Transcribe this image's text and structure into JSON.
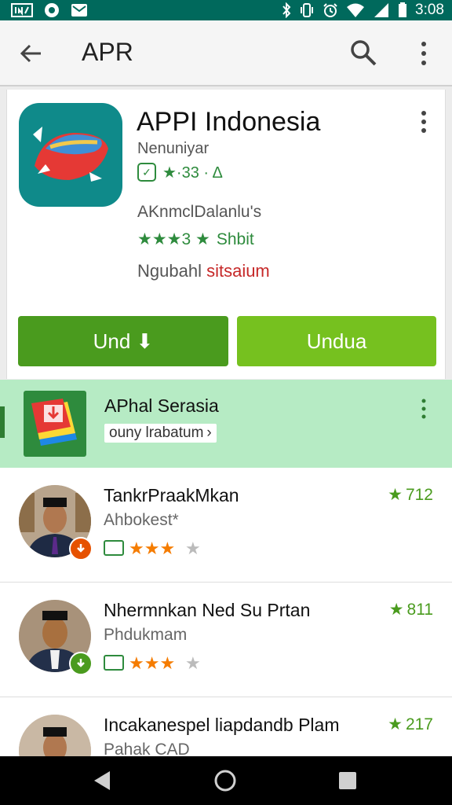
{
  "status_bar": {
    "time": "3:08",
    "left_icons": [
      "notification-app-icon",
      "circle-notification-icon",
      "mail-notification-icon"
    ],
    "right_icons": [
      "bluetooth-icon",
      "vibrate-icon",
      "alarm-icon",
      "wifi-icon",
      "signal-icon",
      "battery-icon"
    ]
  },
  "app_bar": {
    "title": "APR"
  },
  "app_card": {
    "name": "APPI Indonesia",
    "developer": "Nenuniyar",
    "badge_icon": "check-badge-icon",
    "rating_text": "★·33 · Δ",
    "subtitle": "AKnmclDalanlu's",
    "stars_text": "★★★3 ★",
    "stars_label": "Shbit",
    "status_label": "Ngubahl",
    "status_value": "sitsaium",
    "buttons": {
      "primary_label": "Und ⬇",
      "secondary_label": "Undua"
    }
  },
  "promo": {
    "title": "APhal Serasia",
    "chip_label": "ouny lrabatum"
  },
  "list": {
    "items": [
      {
        "title": "TankrPraakMkan",
        "subtitle": "Ahbokest*",
        "rating": "712",
        "stars": 3,
        "badge_color": "#e65100"
      },
      {
        "title": "Nhermnkan Ned Su Prtan",
        "subtitle": "Phdukmam",
        "rating": "811",
        "stars": 3,
        "badge_color": "#4a9b1e"
      },
      {
        "title": "Incakanespel liapdandb Plam",
        "subtitle": "Pahak CAD",
        "rating": "217",
        "stars": 3,
        "badge_color": "#4a9b1e"
      }
    ]
  },
  "colors": {
    "status_bar": "#00695c",
    "primary_button": "#4a9b1e",
    "secondary_button": "#76c11f",
    "promo_background": "#b6ebc4",
    "star_green": "#2e8b3d",
    "star_orange": "#f57c00"
  }
}
